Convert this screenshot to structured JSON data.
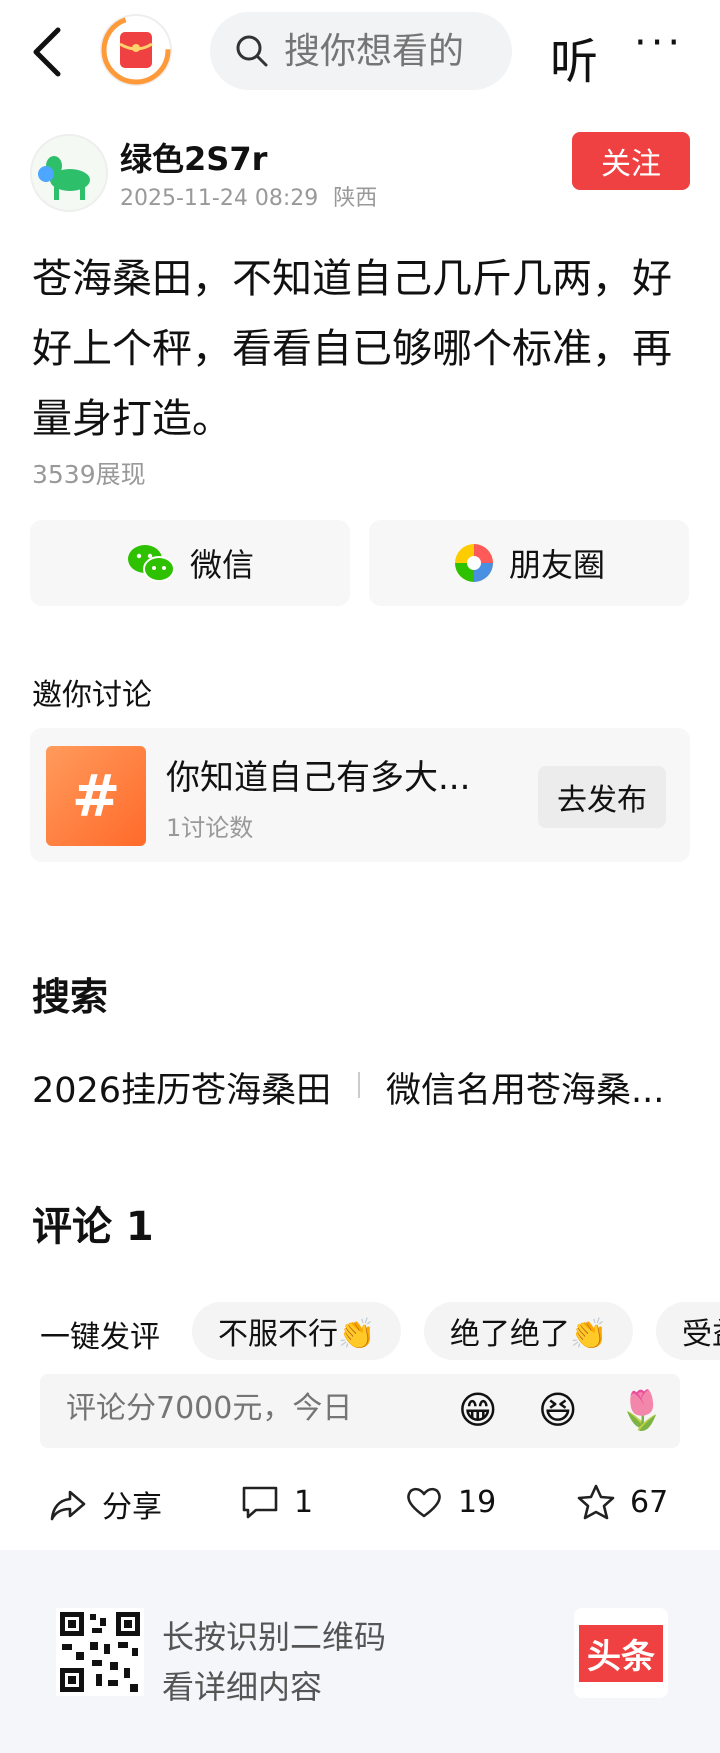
{
  "topbar": {
    "search_placeholder": "搜你想看的",
    "listen_label": "听",
    "more_label": "···"
  },
  "author": {
    "name": "绿色2S7r",
    "timestamp": "2025-11-24 08:29",
    "location": "陕西",
    "follow_label": "关注"
  },
  "post": {
    "text": "苍海桑田，不知道自己几斤几两，好好上个秤，看看自已够哪个标准，再量身打造。",
    "views": "3539展现"
  },
  "share": {
    "wechat_label": "微信",
    "moments_label": "朋友圈"
  },
  "discussion": {
    "section_label": "邀你讨论",
    "topic_title": "你知道自己有多大...",
    "topic_count": "1讨论数",
    "publish_label": "去发布"
  },
  "search": {
    "title": "搜索",
    "suggestions": [
      "2026挂历苍海桑田",
      "微信名用苍海桑..."
    ]
  },
  "comments": {
    "title": "评论 1",
    "quick_label": "一键发评",
    "quick_chips": [
      "不服不行👏",
      "绝了绝了👏",
      "受益"
    ],
    "input_placeholder": "评论分7000元，今日",
    "emojis": [
      "😁",
      "😆",
      "🌷"
    ]
  },
  "actions": {
    "share_label": "分享",
    "comment_count": "1",
    "like_count": "19",
    "favorite_count": "67"
  },
  "footer": {
    "line1": "长按识别二维码",
    "line2": "看详细内容",
    "logo_text": "头条"
  },
  "colors": {
    "accent_red": "#f04142",
    "wechat_green": "#2dc100",
    "topic_orange": "#ff7a3a"
  }
}
